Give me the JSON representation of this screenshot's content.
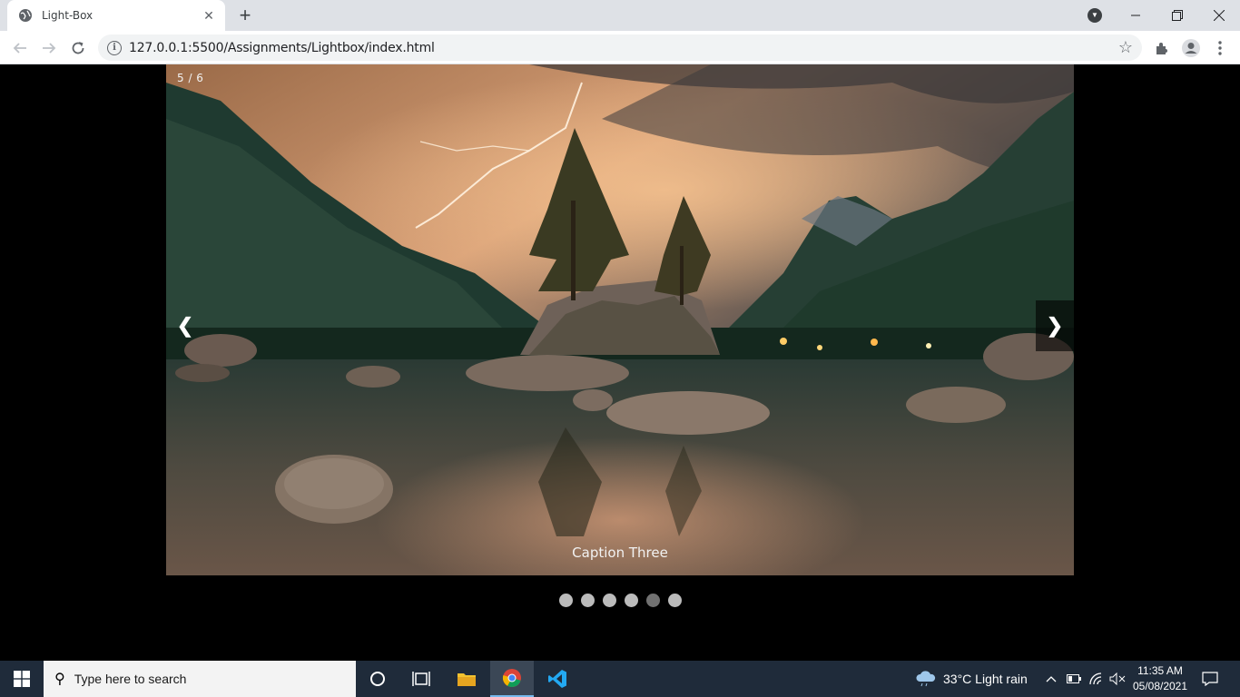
{
  "browser": {
    "tab_title": "Light-Box",
    "url": "127.0.0.1:5500/Assignments/Lightbox/index.html"
  },
  "lightbox": {
    "counter": "5 / 6",
    "caption": "Caption Three",
    "prev_label": "❮",
    "next_label": "❯",
    "dots": [
      {
        "active": false
      },
      {
        "active": false
      },
      {
        "active": false
      },
      {
        "active": false
      },
      {
        "active": true
      },
      {
        "active": false
      }
    ],
    "active_index": 5,
    "total": 6
  },
  "taskbar": {
    "search_placeholder": "Type here to search",
    "weather": "33°C  Light rain",
    "time": "11:35 AM",
    "date": "05/08/2021"
  },
  "colors": {
    "dot": "#bbbbbb",
    "dot_active": "#717171",
    "taskbar": "#1f2b3a"
  }
}
